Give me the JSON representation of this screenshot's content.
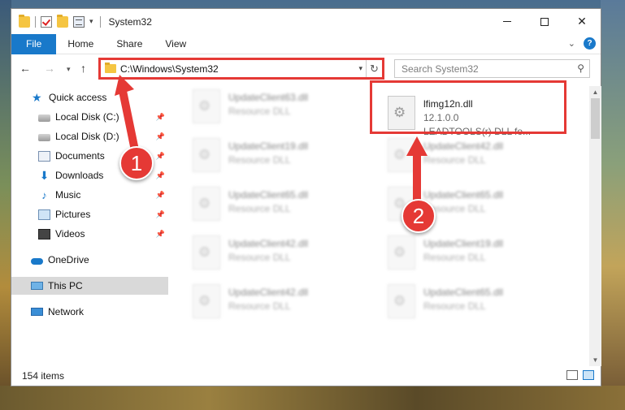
{
  "window": {
    "title": "System32",
    "qa_dropdown": "▾",
    "minimize": "—",
    "maximize": "☐",
    "close": "✕"
  },
  "ribbon": {
    "tabs": [
      "File",
      "Home",
      "Share",
      "View"
    ],
    "help": "?",
    "collapse": "⌄"
  },
  "address": {
    "path": "C:\\Windows\\System32",
    "search_placeholder": "Search System32"
  },
  "sidebar": {
    "items": [
      {
        "label": "Quick access",
        "icon": "star-icon",
        "pinned": false
      },
      {
        "label": "Local Disk (C:)",
        "icon": "disk-icon",
        "pinned": true
      },
      {
        "label": "Local Disk (D:)",
        "icon": "disk-icon",
        "pinned": true
      },
      {
        "label": "Documents",
        "icon": "documents-icon",
        "pinned": true
      },
      {
        "label": "Downloads",
        "icon": "downloads-icon",
        "pinned": true
      },
      {
        "label": "Music",
        "icon": "music-icon",
        "pinned": true
      },
      {
        "label": "Pictures",
        "icon": "pictures-icon",
        "pinned": true
      },
      {
        "label": "Videos",
        "icon": "videos-icon",
        "pinned": true
      },
      {
        "label": "OneDrive",
        "icon": "onedrive-icon",
        "pinned": false
      },
      {
        "label": "This PC",
        "icon": "this-pc-icon",
        "pinned": false,
        "selected": true
      },
      {
        "label": "Network",
        "icon": "network-icon",
        "pinned": false
      }
    ]
  },
  "files": {
    "left": [
      {
        "name": "UpdateClient63.dll",
        "type": "Resource DLL"
      },
      {
        "name": "UpdateClient19.dll",
        "type": "Resource DLL"
      },
      {
        "name": "UpdateClient65.dll",
        "type": "Resource DLL"
      },
      {
        "name": "UpdateClient42.dll",
        "type": "Resource DLL"
      },
      {
        "name": "UpdateClient42.dll",
        "type": "Resource DLL"
      }
    ],
    "right": [
      {
        "name": "lfimg12n.dll",
        "version": "12.1.0.0",
        "description": "LEADTOOLS(r) DLL fo...",
        "highlighted": true
      },
      {
        "name": "UpdateClient42.dll",
        "type": "Resource DLL"
      },
      {
        "name": "UpdateClient65.dll",
        "type": "Resource DLL"
      },
      {
        "name": "UpdateClient19.dll",
        "type": "Resource DLL"
      },
      {
        "name": "UpdateClient65.dll",
        "type": "Resource DLL"
      }
    ]
  },
  "status": {
    "item_count": "154 items"
  },
  "annotations": {
    "callout_1": "1",
    "callout_2": "2",
    "color": "#e53935"
  },
  "colors": {
    "accent": "#1979ca",
    "highlight": "#e53935"
  }
}
